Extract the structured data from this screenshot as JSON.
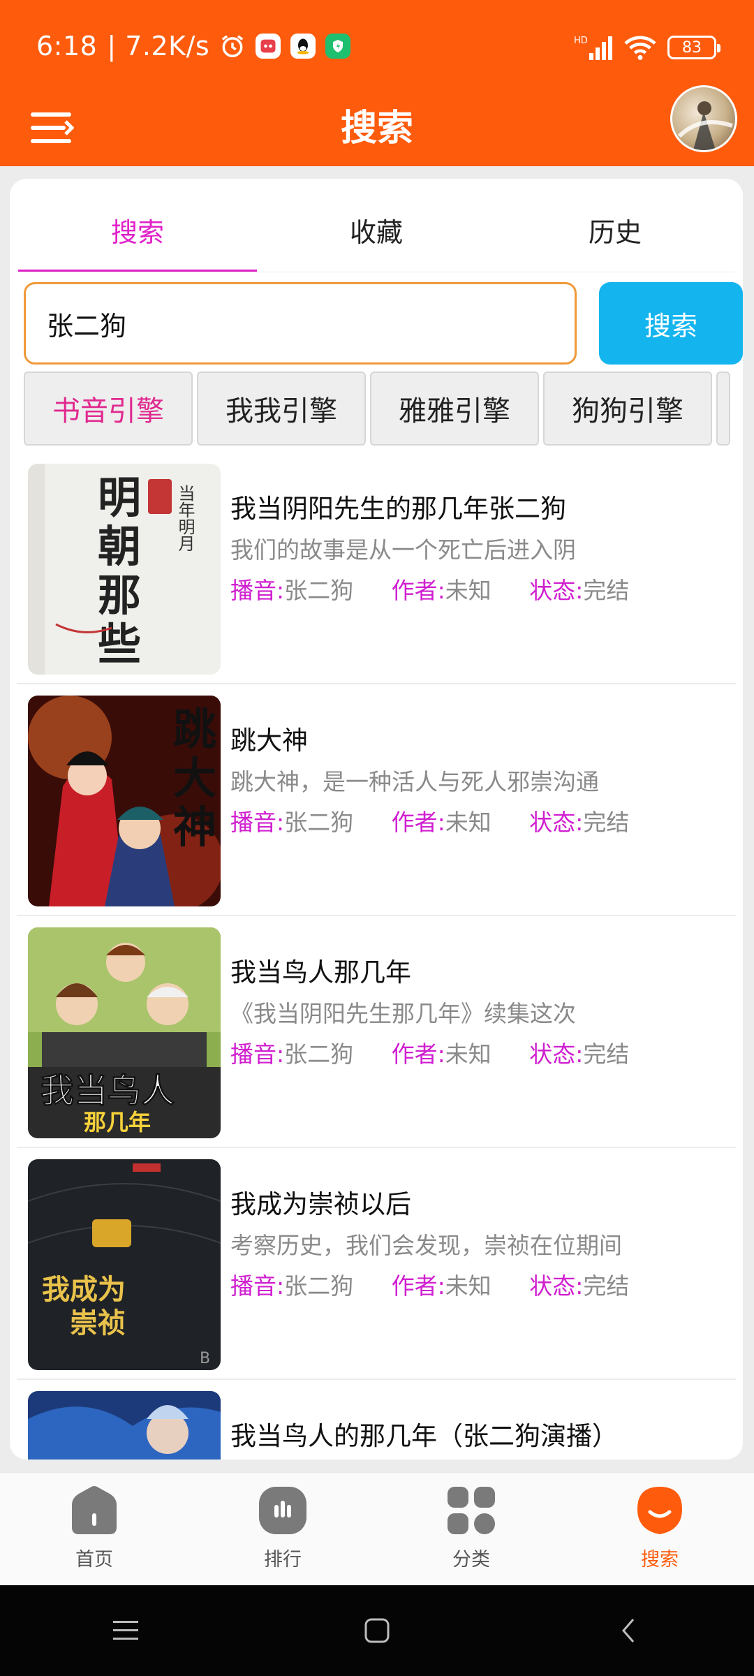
{
  "status_bar": {
    "time": "6:18",
    "speed": "| 7.2K/s",
    "battery": "83",
    "icons": [
      "alarm-icon",
      "app-notification-icon",
      "qq-icon",
      "shield-app-icon",
      "signal-icon",
      "wifi-icon",
      "battery-icon"
    ]
  },
  "header": {
    "title": "搜索",
    "menu_icon": "menu-icon",
    "avatar": "user-avatar"
  },
  "tabs": [
    {
      "label": "搜索",
      "active": true
    },
    {
      "label": "收藏",
      "active": false
    },
    {
      "label": "历史",
      "active": false
    }
  ],
  "search": {
    "value": "张二狗",
    "placeholder": "",
    "button_label": "搜索"
  },
  "engines": [
    {
      "label": "书音引擎",
      "active": true
    },
    {
      "label": "我我引擎",
      "active": false
    },
    {
      "label": "雅雅引擎",
      "active": false
    },
    {
      "label": "狗狗引擎",
      "active": false
    }
  ],
  "meta_labels": {
    "narrator": "播音:",
    "author": "作者:",
    "status": "状态:"
  },
  "results": [
    {
      "title": "我当阴阳先生的那几年张二狗",
      "desc": "我们的故事是从一个死亡后进入阴",
      "narrator": "张二狗",
      "author": "未知",
      "status": "完结",
      "cover_text": "明朝那些事儿",
      "cover_author": "当年明月"
    },
    {
      "title": "跳大神",
      "desc": "跳大神，是一种活人与死人邪崇沟通",
      "narrator": "张二狗",
      "author": "未知",
      "status": "完结",
      "cover_text": "跳大神"
    },
    {
      "title": "我当鸟人那几年",
      "desc": "《我当阴阳先生那几年》续集这次",
      "narrator": "张二狗",
      "author": "未知",
      "status": "完结",
      "cover_text": "我当鸟人",
      "cover_subtext": "那几年"
    },
    {
      "title": "我成为崇祯以后",
      "desc": "考察历史，我们会发现，崇祯在位期间",
      "narrator": "张二狗",
      "author": "未知",
      "status": "完结",
      "cover_text": "我成为崇祯以后"
    },
    {
      "title": "我当鸟人的那几年（张二狗演播）",
      "desc": "",
      "narrator": "",
      "author": "",
      "status": ""
    }
  ],
  "bottom_nav": [
    {
      "label": "首页",
      "icon": "home-icon",
      "active": false
    },
    {
      "label": "排行",
      "icon": "ranking-icon",
      "active": false
    },
    {
      "label": "分类",
      "icon": "category-icon",
      "active": false
    },
    {
      "label": "搜索",
      "icon": "search-icon",
      "active": true
    }
  ],
  "system_nav": [
    "recent-apps-icon",
    "home-button-icon",
    "back-icon"
  ],
  "colors": {
    "brand": "#fe5b0c",
    "accent": "#e020c8",
    "search_button": "#14b5ee",
    "input_border": "#ef9a3a"
  }
}
